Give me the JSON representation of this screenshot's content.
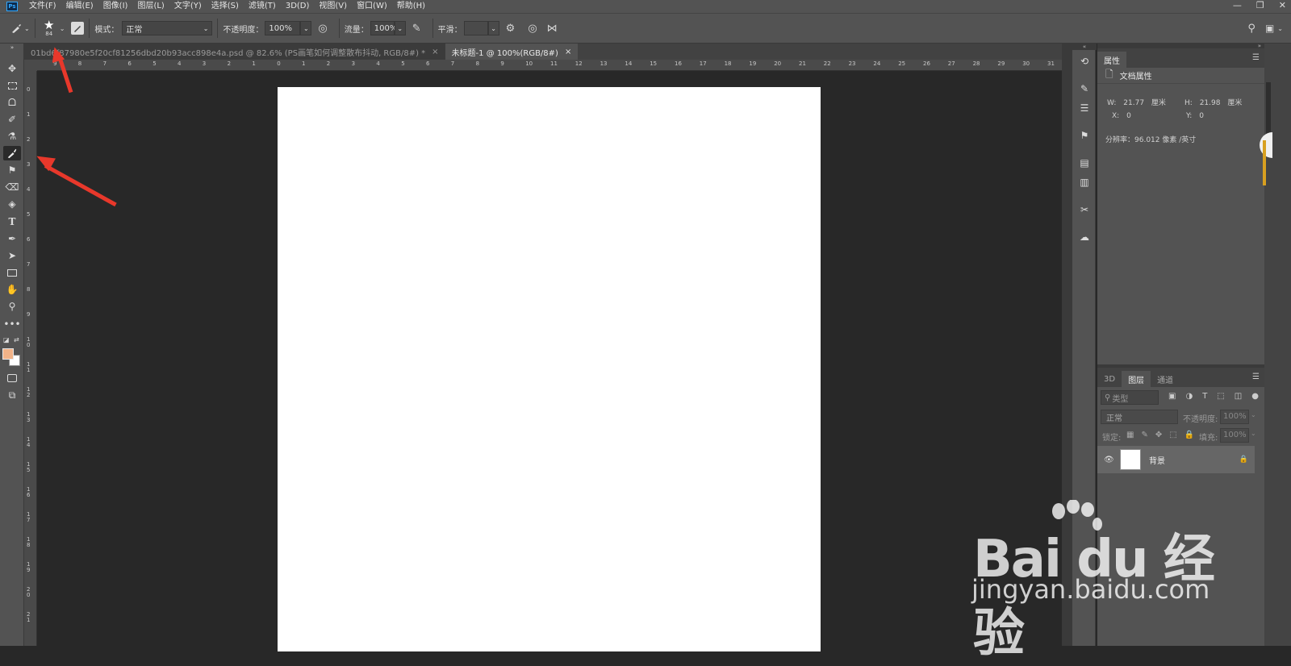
{
  "app": {
    "logo": "Ps"
  },
  "menu": [
    "文件(F)",
    "编辑(E)",
    "图像(I)",
    "图层(L)",
    "文字(Y)",
    "选择(S)",
    "滤镜(T)",
    "3D(D)",
    "视图(V)",
    "窗口(W)",
    "帮助(H)"
  ],
  "window_buttons": {
    "minimize": "—",
    "restore": "❐",
    "close": "✕"
  },
  "options": {
    "brush_size": "84",
    "mode_label": "模式：",
    "mode_value": "正常",
    "opacity_label": "不透明度：",
    "opacity_value": "100%",
    "flow_label": "流量：",
    "flow_value": "100%",
    "smooth_label": "平滑：",
    "smooth_value": ""
  },
  "tabs": [
    {
      "label": "01bd6f87980e5f20cf81256dbd20b93acc898e4a.psd @ 82.6% (PS画笔如何调整散布抖动, RGB/8#) *",
      "close": "×"
    },
    {
      "label": "未标题-1 @ 100%(RGB/8#)",
      "close": "×"
    }
  ],
  "ruler_top_labels": [
    "9",
    "8",
    "7",
    "6",
    "5",
    "4",
    "3",
    "2",
    "1",
    "0",
    "1",
    "2",
    "3",
    "4",
    "5",
    "6",
    "7",
    "8",
    "9",
    "10",
    "11",
    "12",
    "13",
    "14",
    "15",
    "16",
    "17",
    "18",
    "19",
    "20",
    "21",
    "22",
    "23",
    "24",
    "25",
    "26",
    "27",
    "28",
    "29",
    "30",
    "31"
  ],
  "ruler_left_labels": [
    "0",
    "1",
    "2",
    "3",
    "4",
    "5",
    "6",
    "7",
    "8",
    "9",
    "10",
    "11",
    "12",
    "13",
    "14",
    "15",
    "16",
    "17",
    "18",
    "19",
    "20",
    "21"
  ],
  "properties": {
    "tab": "属性",
    "section": "文档属性",
    "w_label": "W:",
    "w_value": "21.77",
    "w_unit": "厘米",
    "h_label": "H:",
    "h_value": "21.98",
    "h_unit": "厘米",
    "x_label": "X:",
    "x_value": "0",
    "y_label": "Y:",
    "y_value": "0",
    "resolution": "分辨率：96.012 像素 /英寸"
  },
  "layers_panel": {
    "tabs": [
      "3D",
      "图层",
      "通道"
    ],
    "filter_placeholder": "类型",
    "blend_mode": "正常",
    "opacity_label": "不透明度:",
    "opacity_value": "100%",
    "lock_label": "锁定:",
    "fill_label": "填充:",
    "fill_value": "100%",
    "layers": [
      {
        "name": "背景"
      }
    ]
  },
  "colors": {
    "foreground": "#f2b388",
    "background": "#ffffff",
    "accent": "#31a8ff",
    "arrow": "#e8382b"
  },
  "watermark": {
    "brand": "Bai du 经验",
    "url": "jingyan.baidu.com"
  }
}
